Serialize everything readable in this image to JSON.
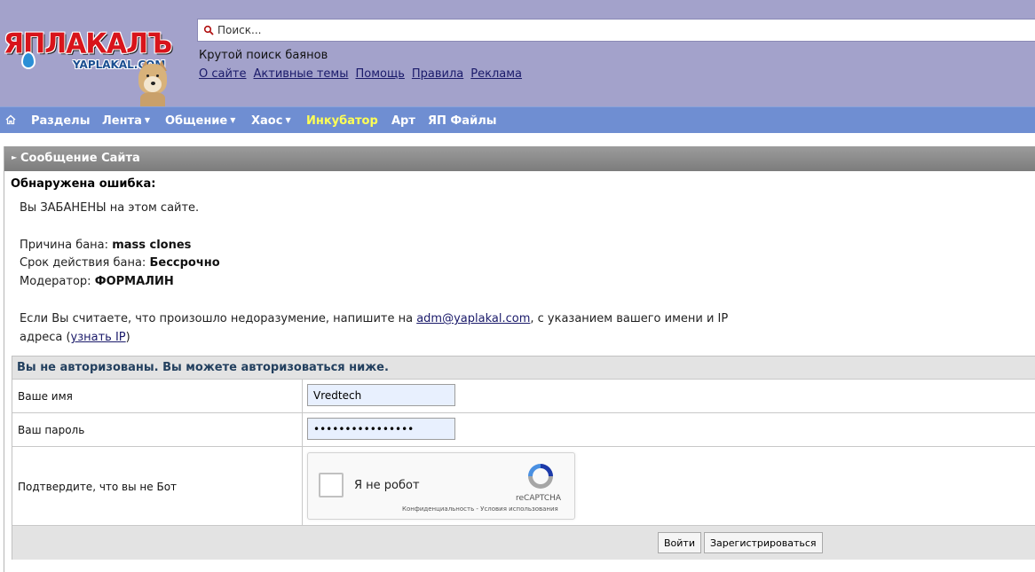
{
  "header": {
    "logo_text": "ЯПЛАКАЛЪ",
    "logo_sub": "YAPLAKAL.COM",
    "search_placeholder": "Поиск...",
    "tagline": "Крутой поиск баянов",
    "links": [
      "О сайте",
      "Активные темы",
      "Помощь",
      "Правила",
      "Реклама"
    ]
  },
  "nav": {
    "items": [
      {
        "label": "Разделы",
        "dropdown": false
      },
      {
        "label": "Лента",
        "dropdown": true
      },
      {
        "label": "Общение",
        "dropdown": true
      },
      {
        "label": "Хаос",
        "dropdown": true
      },
      {
        "label": "Инкубатор",
        "dropdown": false,
        "highlight": true
      },
      {
        "label": "Арт",
        "dropdown": false
      },
      {
        "label": "ЯП Файлы",
        "dropdown": false
      }
    ]
  },
  "message": {
    "title": "Сообщение Сайта",
    "error_heading": "Обнаружена ошибка:",
    "banned_text": "Вы ЗАБАНЕНЫ на этом сайте.",
    "reason_label": "Причина бана:",
    "reason_value": "mass clones",
    "term_label": "Срок действия бана:",
    "term_value": "Бессрочно",
    "moderator_label": "Модератор:",
    "moderator_value": "ФОРМАЛИН",
    "contact_pre": "Если Вы считаете, что произошло недоразумение, напишите на",
    "contact_email": "adm@yaplakal.com",
    "contact_post": ", с указанием вашего имени и IP",
    "contact_line2_pre": "адреса (",
    "contact_ip_link": "узнать IP",
    "contact_line2_post": ")"
  },
  "login": {
    "heading": "Вы не авторизованы. Вы можете авторизоваться ниже.",
    "name_label": "Ваше имя",
    "name_value": "Vredtech",
    "password_label": "Ваш пароль",
    "password_value": "••••••••••••••••",
    "captcha_label": "Подтвердите, что вы не Бот",
    "captcha_checkbox_text": "Я не робот",
    "captcha_brand": "reCAPTCHA",
    "captcha_links": "Конфиденциальность - Условия использования",
    "login_button": "Войти",
    "register_button": "Зарегистрироваться"
  }
}
